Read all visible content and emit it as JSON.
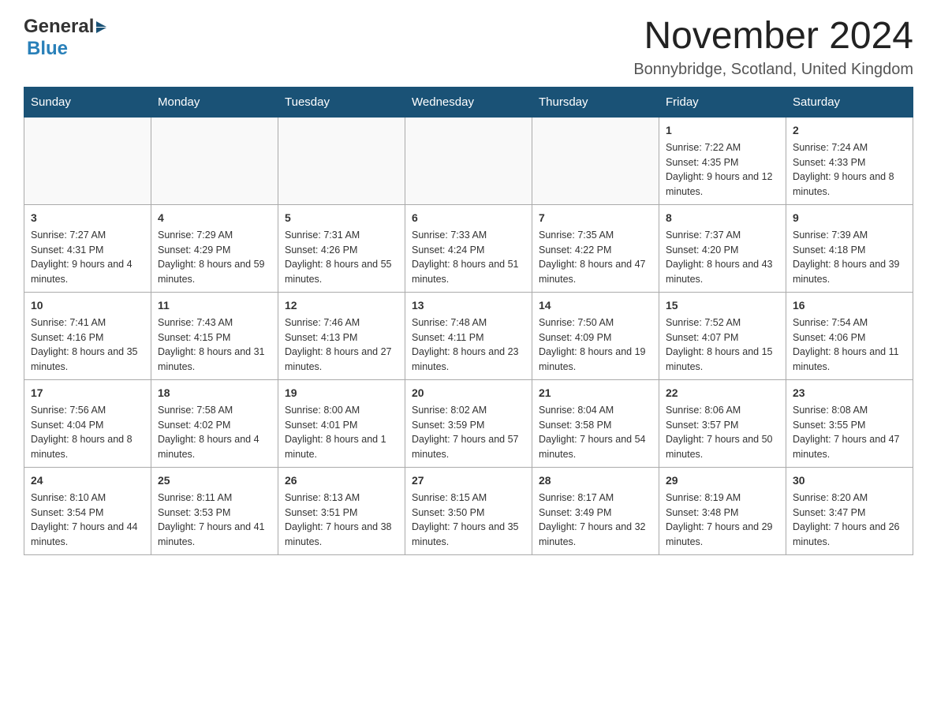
{
  "logo": {
    "general": "General",
    "blue": "Blue"
  },
  "header": {
    "month": "November 2024",
    "location": "Bonnybridge, Scotland, United Kingdom"
  },
  "weekdays": [
    "Sunday",
    "Monday",
    "Tuesday",
    "Wednesday",
    "Thursday",
    "Friday",
    "Saturday"
  ],
  "weeks": [
    [
      {
        "day": "",
        "info": ""
      },
      {
        "day": "",
        "info": ""
      },
      {
        "day": "",
        "info": ""
      },
      {
        "day": "",
        "info": ""
      },
      {
        "day": "",
        "info": ""
      },
      {
        "day": "1",
        "info": "Sunrise: 7:22 AM\nSunset: 4:35 PM\nDaylight: 9 hours and 12 minutes."
      },
      {
        "day": "2",
        "info": "Sunrise: 7:24 AM\nSunset: 4:33 PM\nDaylight: 9 hours and 8 minutes."
      }
    ],
    [
      {
        "day": "3",
        "info": "Sunrise: 7:27 AM\nSunset: 4:31 PM\nDaylight: 9 hours and 4 minutes."
      },
      {
        "day": "4",
        "info": "Sunrise: 7:29 AM\nSunset: 4:29 PM\nDaylight: 8 hours and 59 minutes."
      },
      {
        "day": "5",
        "info": "Sunrise: 7:31 AM\nSunset: 4:26 PM\nDaylight: 8 hours and 55 minutes."
      },
      {
        "day": "6",
        "info": "Sunrise: 7:33 AM\nSunset: 4:24 PM\nDaylight: 8 hours and 51 minutes."
      },
      {
        "day": "7",
        "info": "Sunrise: 7:35 AM\nSunset: 4:22 PM\nDaylight: 8 hours and 47 minutes."
      },
      {
        "day": "8",
        "info": "Sunrise: 7:37 AM\nSunset: 4:20 PM\nDaylight: 8 hours and 43 minutes."
      },
      {
        "day": "9",
        "info": "Sunrise: 7:39 AM\nSunset: 4:18 PM\nDaylight: 8 hours and 39 minutes."
      }
    ],
    [
      {
        "day": "10",
        "info": "Sunrise: 7:41 AM\nSunset: 4:16 PM\nDaylight: 8 hours and 35 minutes."
      },
      {
        "day": "11",
        "info": "Sunrise: 7:43 AM\nSunset: 4:15 PM\nDaylight: 8 hours and 31 minutes."
      },
      {
        "day": "12",
        "info": "Sunrise: 7:46 AM\nSunset: 4:13 PM\nDaylight: 8 hours and 27 minutes."
      },
      {
        "day": "13",
        "info": "Sunrise: 7:48 AM\nSunset: 4:11 PM\nDaylight: 8 hours and 23 minutes."
      },
      {
        "day": "14",
        "info": "Sunrise: 7:50 AM\nSunset: 4:09 PM\nDaylight: 8 hours and 19 minutes."
      },
      {
        "day": "15",
        "info": "Sunrise: 7:52 AM\nSunset: 4:07 PM\nDaylight: 8 hours and 15 minutes."
      },
      {
        "day": "16",
        "info": "Sunrise: 7:54 AM\nSunset: 4:06 PM\nDaylight: 8 hours and 11 minutes."
      }
    ],
    [
      {
        "day": "17",
        "info": "Sunrise: 7:56 AM\nSunset: 4:04 PM\nDaylight: 8 hours and 8 minutes."
      },
      {
        "day": "18",
        "info": "Sunrise: 7:58 AM\nSunset: 4:02 PM\nDaylight: 8 hours and 4 minutes."
      },
      {
        "day": "19",
        "info": "Sunrise: 8:00 AM\nSunset: 4:01 PM\nDaylight: 8 hours and 1 minute."
      },
      {
        "day": "20",
        "info": "Sunrise: 8:02 AM\nSunset: 3:59 PM\nDaylight: 7 hours and 57 minutes."
      },
      {
        "day": "21",
        "info": "Sunrise: 8:04 AM\nSunset: 3:58 PM\nDaylight: 7 hours and 54 minutes."
      },
      {
        "day": "22",
        "info": "Sunrise: 8:06 AM\nSunset: 3:57 PM\nDaylight: 7 hours and 50 minutes."
      },
      {
        "day": "23",
        "info": "Sunrise: 8:08 AM\nSunset: 3:55 PM\nDaylight: 7 hours and 47 minutes."
      }
    ],
    [
      {
        "day": "24",
        "info": "Sunrise: 8:10 AM\nSunset: 3:54 PM\nDaylight: 7 hours and 44 minutes."
      },
      {
        "day": "25",
        "info": "Sunrise: 8:11 AM\nSunset: 3:53 PM\nDaylight: 7 hours and 41 minutes."
      },
      {
        "day": "26",
        "info": "Sunrise: 8:13 AM\nSunset: 3:51 PM\nDaylight: 7 hours and 38 minutes."
      },
      {
        "day": "27",
        "info": "Sunrise: 8:15 AM\nSunset: 3:50 PM\nDaylight: 7 hours and 35 minutes."
      },
      {
        "day": "28",
        "info": "Sunrise: 8:17 AM\nSunset: 3:49 PM\nDaylight: 7 hours and 32 minutes."
      },
      {
        "day": "29",
        "info": "Sunrise: 8:19 AM\nSunset: 3:48 PM\nDaylight: 7 hours and 29 minutes."
      },
      {
        "day": "30",
        "info": "Sunrise: 8:20 AM\nSunset: 3:47 PM\nDaylight: 7 hours and 26 minutes."
      }
    ]
  ]
}
